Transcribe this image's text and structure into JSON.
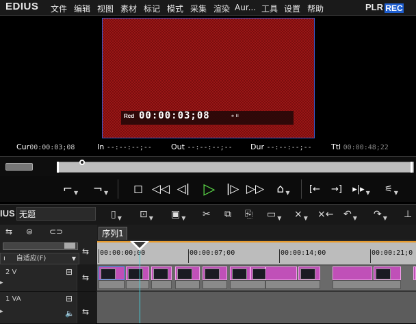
{
  "app": {
    "logo": "EDIUS",
    "plr": "PLR",
    "rec": "REC"
  },
  "menu": [
    "文件",
    "编辑",
    "视图",
    "素材",
    "标记",
    "模式",
    "采集",
    "渲染",
    "Aur...",
    "工具",
    "设置",
    "帮助"
  ],
  "preview": {
    "tc_label": "Rcd",
    "timecode": "00:00:03;08",
    "icons": "⁎  ıı"
  },
  "tc_info": {
    "cur_label": "Cur",
    "cur": "00:00:03;08",
    "in_label": "In",
    "in": "--:--:--;--",
    "out_label": "Out",
    "out": "--:--:--;--",
    "dur_label": "Dur",
    "dur": "--:--:--;--",
    "ttl_label": "Ttl",
    "ttl": "00:00:48;22"
  },
  "timeline": {
    "logo_small": "IUS",
    "project_name": "无题",
    "sequence_tab": "序列1",
    "ruler": [
      "00:00:00;00",
      "00:00:07;00",
      "00:00:14;00",
      "00:00:21;0"
    ],
    "mode_label": "自适应(F)"
  },
  "tracks": [
    {
      "name": "2 V",
      "type": "video"
    },
    {
      "name": "1 VA",
      "type": "audio-video"
    }
  ],
  "colors": {
    "rec_bg": "#1f5fd0",
    "clip": "#c050b8",
    "playhead": "#44d4e0",
    "play_button": "#5ee04a"
  }
}
